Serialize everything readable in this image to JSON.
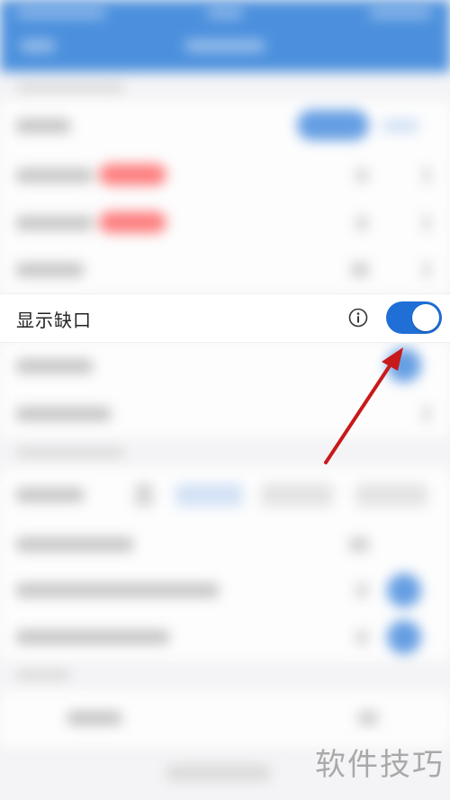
{
  "settings": {
    "show_gap": {
      "label": "显示缺口",
      "enabled": true
    }
  },
  "watermark": "软件技巧",
  "colors": {
    "header": "#2f7fd9",
    "toggle_on": "#1f6fd6",
    "arrow": "#c8191b"
  },
  "icons": {
    "info": "info-circle-icon",
    "annotation": "arrow-icon"
  }
}
